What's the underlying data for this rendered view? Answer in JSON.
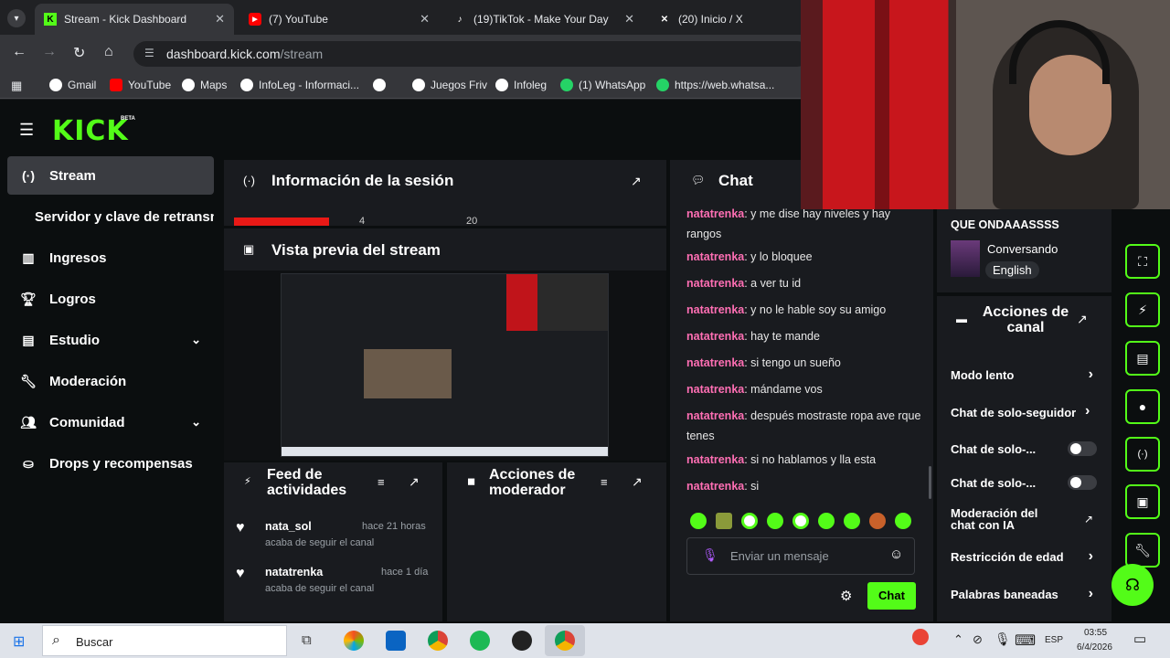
{
  "browser": {
    "tabs": [
      {
        "title": "Stream - Kick Dashboard",
        "icon": "kick-icon"
      },
      {
        "title": "(7) YouTube",
        "icon": "youtube-icon"
      },
      {
        "title": "(19)TikTok - Make Your Day",
        "icon": "tiktok-icon"
      },
      {
        "title": "(20) Inicio / X",
        "icon": "x-icon"
      }
    ],
    "close_glyph": "✕",
    "url_host": "dashboard.kick.com",
    "url_path": "/stream",
    "bookmarks": [
      "Gmail",
      "YouTube",
      "Maps",
      "InfoLeg - Informaci...",
      "Juegos Friv",
      "Infoleg",
      "(1) WhatsApp",
      "https://web.whatsa..."
    ]
  },
  "app": {
    "logo": "KICK",
    "logo_badge": "BETA",
    "sidebar": [
      {
        "label": "Stream",
        "icon": "broadcast-icon"
      },
      {
        "label": "Servidor y clave de retransn",
        "icon": ""
      },
      {
        "label": "Ingresos",
        "icon": "chart-icon"
      },
      {
        "label": "Logros",
        "icon": "trophy-icon"
      },
      {
        "label": "Estudio",
        "icon": "studio-icon"
      },
      {
        "label": "Moderación",
        "icon": "wrench-icon"
      },
      {
        "label": "Comunidad",
        "icon": "people-icon"
      },
      {
        "label": "Drops y recompensas",
        "icon": "gift-icon"
      }
    ],
    "session_title": "Información de la sesión",
    "session_stats": [
      "4",
      "20"
    ],
    "preview_title": "Vista previa del stream",
    "feed_title": "Feed de actividades",
    "feed": [
      {
        "user": "nata_sol",
        "time": "hace 21 horas",
        "action": "acaba de seguir el canal"
      },
      {
        "user": "natatrenka",
        "time": "hace 1 día",
        "action": "acaba de seguir el canal"
      }
    ],
    "mod_title": "Acciones de moderador",
    "chat_title": "Chat",
    "chat_messages": [
      {
        "user": "natatrenka",
        "text": ": y me dise hay niveles y hay rangos"
      },
      {
        "user": "natatrenka",
        "text": ": y lo bloquee"
      },
      {
        "user": "natatrenka",
        "text": ": a ver tu id"
      },
      {
        "user": "natatrenka",
        "text": ": y no le hable soy su amigo"
      },
      {
        "user": "natatrenka",
        "text": ": hay te mande"
      },
      {
        "user": "natatrenka",
        "text": ": si tengo un sueño"
      },
      {
        "user": "natatrenka",
        "text": ": mándame vos"
      },
      {
        "user": "natatrenka",
        "text": ": después mostraste ropa ave rque tenes"
      },
      {
        "user": "natatrenka",
        "text": ": si no hablamos y lla esta"
      },
      {
        "user": "natatrenka",
        "text": ": si"
      }
    ],
    "chat_placeholder": "Enviar un mensaje",
    "chat_button": "Chat",
    "stream_title": "QUE ONDAAASSSS",
    "category": "Conversando",
    "language": "English",
    "channel_actions_title": "Acciones de canal",
    "channel_actions": [
      {
        "label": "Modo lento",
        "control": "arrow"
      },
      {
        "label": "Chat de solo-seguidor",
        "control": "arrow"
      },
      {
        "label": "Chat de solo-...",
        "control": "toggle",
        "on": false
      },
      {
        "label": "Chat de solo-...",
        "control": "toggle",
        "on": false
      },
      {
        "label": "Moderación del chat con IA",
        "control": "external"
      },
      {
        "label": "Restricción de edad",
        "control": "arrow"
      },
      {
        "label": "Palabras baneadas",
        "control": "arrow"
      }
    ],
    "accent": "#53fc18"
  },
  "taskbar": {
    "search": "Buscar",
    "lang": "ESP",
    "time": "03:55",
    "date": "6/4/2026"
  }
}
